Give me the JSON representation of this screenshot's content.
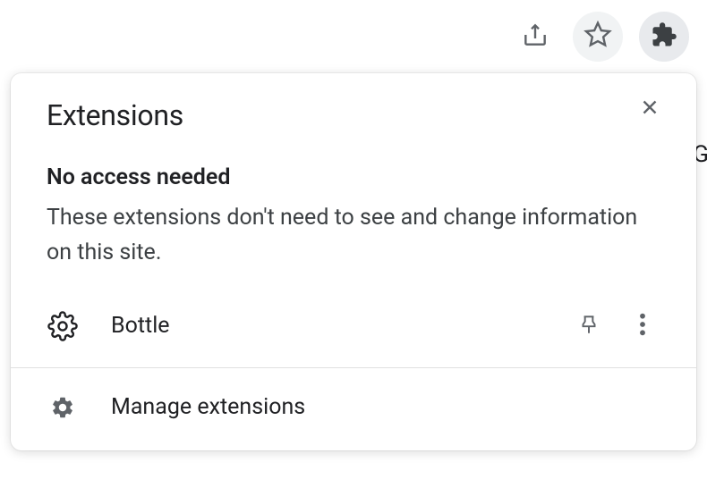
{
  "popup": {
    "title": "Extensions",
    "section_heading": "No access needed",
    "section_description": "These extensions don't need to see and change information on this site.",
    "extension_name": "Bottle",
    "manage_label": "Manage extensions"
  }
}
